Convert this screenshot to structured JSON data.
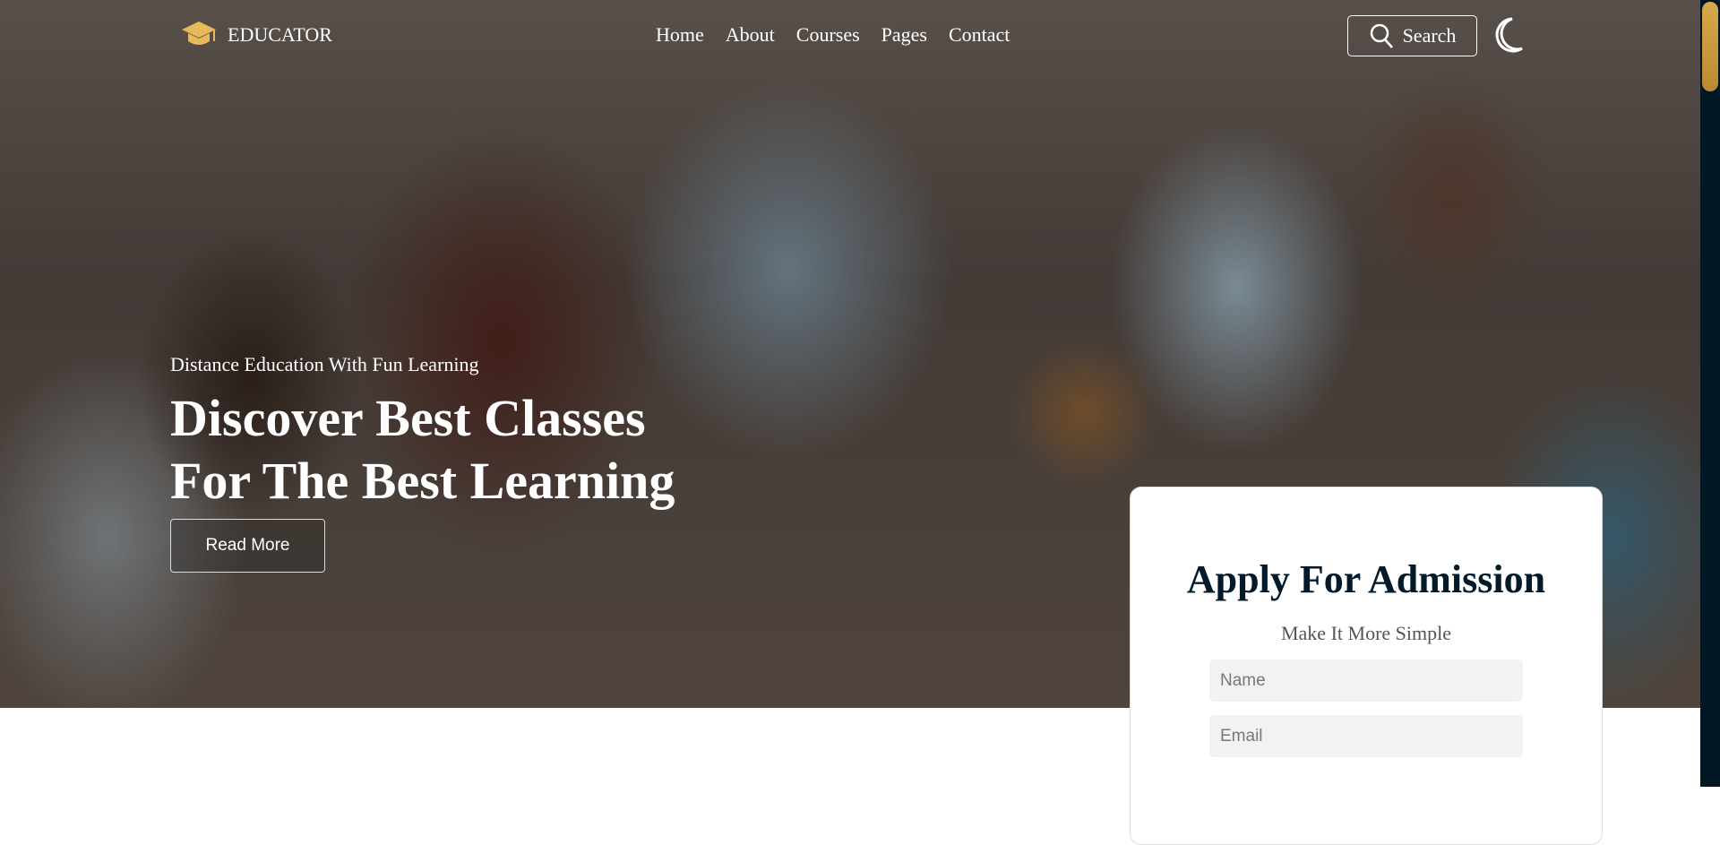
{
  "header": {
    "logo_text": "EDUCATOR",
    "nav": [
      "Home",
      "About",
      "Courses",
      "Pages",
      "Contact"
    ],
    "search_label": "Search"
  },
  "hero": {
    "subtitle": "Distance Education With Fun Learning",
    "title_line1": "Discover Best Classes",
    "title_line2": "For The Best Learning",
    "button": "Read More"
  },
  "admission": {
    "title": "Apply For Admission",
    "subtitle": "Make It More Simple",
    "name_placeholder": "Name",
    "email_placeholder": "Email"
  },
  "colors": {
    "accent": "#e8b95a",
    "dark": "#031a2a"
  }
}
